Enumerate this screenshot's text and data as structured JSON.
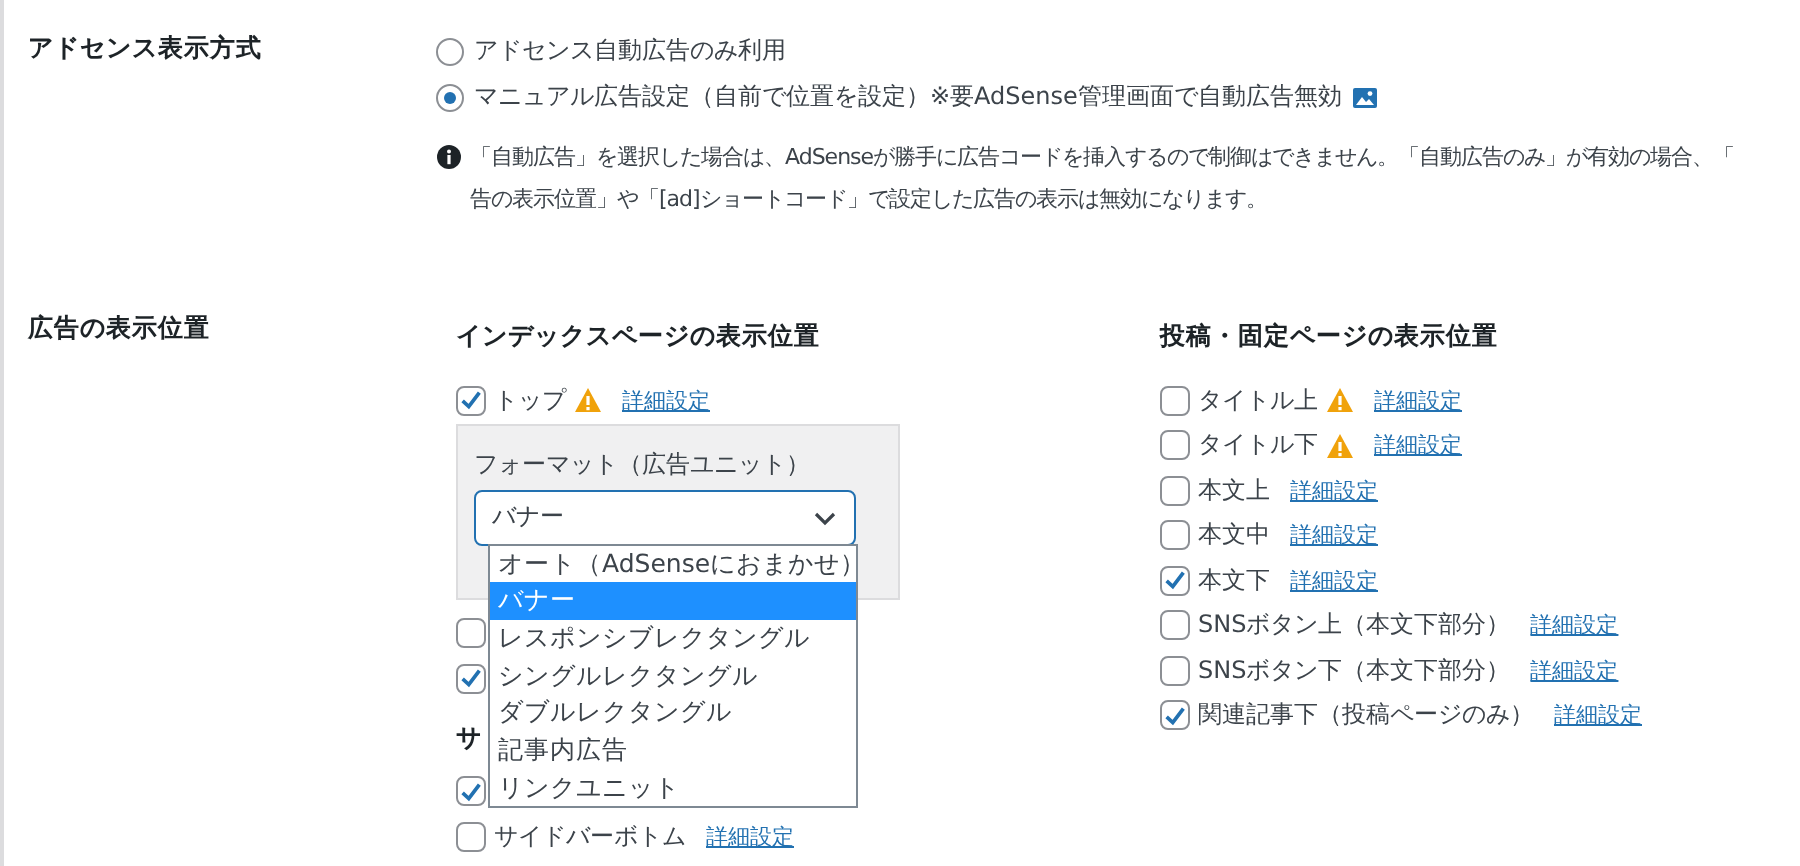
{
  "display_mode": {
    "label": "アドセンス表示方式",
    "options": [
      {
        "label": "アドセンス自動広告のみ利用",
        "selected": false,
        "image_icon": false
      },
      {
        "label": "マニュアル広告設定（自前で位置を設定）※要AdSense管理画面で自動広告無効",
        "selected": true,
        "image_icon": true
      }
    ],
    "note_lines": [
      "「自動広告」を選択した場合は、AdSenseが勝手に広告コードを挿入するので制御はできません。「自動広告のみ」が有効の場合、「",
      "告の表示位置」や「[ad]ショートコード」で設定した広告の表示は無効になります。"
    ]
  },
  "positions": {
    "label": "広告の表示位置",
    "index_column": {
      "heading": "インデックスページの表示位置",
      "items": [
        {
          "label": "トップ",
          "checked": true,
          "warning": true,
          "link": "詳細設定"
        },
        {
          "checked": false
        },
        {
          "checked": true
        }
      ],
      "format_panel": {
        "label": "フォーマット（広告ユニット）",
        "value": "バナー",
        "expanded": true,
        "options": [
          {
            "label": "オート（AdSenseにおまかせ）",
            "selected": false
          },
          {
            "label": "バナー",
            "selected": true
          },
          {
            "label": "レスポンシブレクタングル",
            "selected": false
          },
          {
            "label": "シングルレクタングル",
            "selected": false
          },
          {
            "label": "ダブルレクタングル",
            "selected": false
          },
          {
            "label": "記事内広告",
            "selected": false
          },
          {
            "label": "リンクユニット",
            "selected": false
          }
        ]
      },
      "sidebar_heading": "サ",
      "sidebar_items": [
        {
          "checked": true
        },
        {
          "label": "サイドバーボトム",
          "checked": false,
          "warning": false,
          "link": "詳細設定"
        }
      ]
    },
    "post_column": {
      "heading": "投稿・固定ページの表示位置",
      "items": [
        {
          "label": "タイトル上",
          "checked": false,
          "warning": true,
          "link": "詳細設定"
        },
        {
          "label": "タイトル下",
          "checked": false,
          "warning": true,
          "link": "詳細設定"
        },
        {
          "label": "本文上",
          "checked": false,
          "warning": false,
          "link": "詳細設定"
        },
        {
          "label": "本文中",
          "checked": false,
          "warning": false,
          "link": "詳細設定"
        },
        {
          "label": "本文下",
          "checked": true,
          "warning": false,
          "link": "詳細設定"
        },
        {
          "label": "SNSボタン上（本文下部分）",
          "checked": false,
          "warning": false,
          "link": "詳細設定"
        },
        {
          "label": "SNSボタン下（本文下部分）",
          "checked": false,
          "warning": false,
          "link": "詳細設定"
        },
        {
          "label": "関連記事下（投稿ページのみ）",
          "checked": true,
          "warning": false,
          "link": "詳細設定"
        }
      ]
    }
  }
}
